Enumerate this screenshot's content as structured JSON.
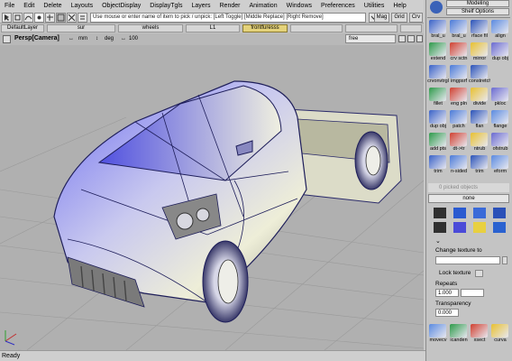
{
  "menubar": {
    "items": [
      "File",
      "Edit",
      "Delete",
      "Layouts",
      "ObjectDisplay",
      "DisplayTgls",
      "Layers",
      "Render",
      "Animation",
      "Windows",
      "Preferences",
      "Utilities",
      "Help"
    ]
  },
  "toolbar": {
    "prompt": "Use mouse or enter name of item to pick / unpick: [Left Toggle] [Middle Replace] [Right Remove]",
    "mag_label": "Mag",
    "grid_label": "Grid",
    "crv_label": "Crv"
  },
  "layers": {
    "items": [
      "DefaultLayer",
      "sur",
      "wheels",
      "L1",
      "frontfuresss"
    ],
    "active_index": 4
  },
  "viewport": {
    "title": "Persp[Camera]",
    "unit_mm": "mm",
    "unit_deg": "deg",
    "zoom": "100",
    "mode": "free"
  },
  "shelf": {
    "title": "Modeling",
    "subtitle": "Shelf Options",
    "tools": [
      {
        "label": "bral_u",
        "icon": "bral-u-icon"
      },
      {
        "label": "bral_u",
        "icon": "bral-u2-icon"
      },
      {
        "label": "rface fil",
        "icon": "surface-fillet-icon"
      },
      {
        "label": "align",
        "icon": "align-icon"
      },
      {
        "label": "extend",
        "icon": "extend-icon"
      },
      {
        "label": "crv sctn",
        "icon": "curve-section-icon"
      },
      {
        "label": "mirror",
        "icon": "mirror-icon"
      },
      {
        "label": "dup obj",
        "icon": "duplicate-object-icon"
      },
      {
        "label": "crvonvtrgl",
        "icon": "curve-on-surface-icon"
      },
      {
        "label": "imgpsrf",
        "icon": "image-surface-icon"
      },
      {
        "label": "constretch",
        "icon": "constretch-icon"
      },
      {
        "label": "",
        "icon": "blank-icon"
      },
      {
        "label": "fillet",
        "icon": "fillet-icon"
      },
      {
        "label": "eng pln",
        "icon": "engineering-plane-icon"
      },
      {
        "label": "divide",
        "icon": "divide-icon"
      },
      {
        "label": "pkloc",
        "icon": "pick-locator-icon"
      },
      {
        "label": "dup obj",
        "icon": "dup-obj-icon"
      },
      {
        "label": "patch",
        "icon": "patch-icon"
      },
      {
        "label": "flan",
        "icon": "flange-icon"
      },
      {
        "label": "flange",
        "icon": "flange2-icon"
      },
      {
        "label": "add pts",
        "icon": "add-points-icon"
      },
      {
        "label": "dt->tr",
        "icon": "detach-trim-icon"
      },
      {
        "label": "ntrub",
        "icon": "untrim-icon"
      },
      {
        "label": "ofstrub",
        "icon": "offset-trim-icon"
      },
      {
        "label": "trim",
        "icon": "trim-icon"
      },
      {
        "label": "n-sided",
        "icon": "n-sided-icon"
      },
      {
        "label": "trim",
        "icon": "trim2-icon"
      },
      {
        "label": "eform",
        "icon": "eform-icon"
      }
    ],
    "picked": "0 picked objects",
    "picked_value": "none",
    "texture_label": "Change texture to",
    "lock_label": "Lock texture",
    "repeats_label": "Repeats",
    "repeats_value": "1.000",
    "transparency_label": "Transparency",
    "transparency_value": "0.000",
    "bottom_tools": [
      {
        "label": "movecv",
        "icon": "move-cv-icon"
      },
      {
        "label": "icanden",
        "icon": "icandesign-icon"
      },
      {
        "label": "xsect",
        "icon": "cross-section-icon"
      },
      {
        "label": "curva",
        "icon": "curvature-icon"
      }
    ]
  },
  "statusline": {
    "text": "Ready"
  }
}
